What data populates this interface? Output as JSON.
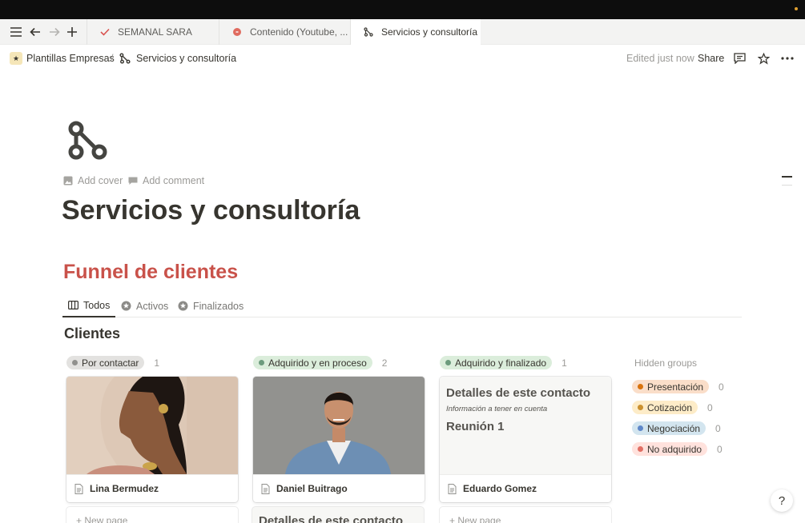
{
  "browser": {
    "tabs": [
      {
        "label": "SEMANAL SARA",
        "icon": "checkmark-icon",
        "icon_color": "#d9534f"
      },
      {
        "label": "Contenido (Youtube, ...",
        "icon": "red-circle-icon",
        "icon_color": "#e06b5f"
      },
      {
        "label": "Servicios y consultoría",
        "icon": "branch-icon"
      }
    ]
  },
  "header": {
    "breadcrumb_parent": "Plantillas Empresas",
    "breadcrumb_separator": "/",
    "breadcrumb_current": "Servicios y consultoría",
    "edited": "Edited just now",
    "share": "Share"
  },
  "page": {
    "add_cover": "Add cover",
    "add_comment": "Add comment",
    "title": "Servicios y consultoría",
    "section_heading": "Funnel de clientes",
    "section_heading_color": "#c9524a"
  },
  "views": [
    {
      "label": "Todos",
      "icon": "board-icon"
    },
    {
      "label": "Activos",
      "icon": "star-circle-icon"
    },
    {
      "label": "Finalizados",
      "icon": "star-circle-icon"
    }
  ],
  "database": {
    "title": "Clientes",
    "columns": [
      {
        "label": "Por contactar",
        "count": "1",
        "pill_bg": "#e3e2e0",
        "dot": "#91918e",
        "card": {
          "name": "Lina Bermudez",
          "image": "woman-portrait"
        },
        "new_page": "+ New page"
      },
      {
        "label": "Adquirido y en proceso",
        "count": "2",
        "pill_bg": "#dbeddb",
        "dot": "#6c9b7d",
        "card": {
          "name": "Daniel Buitrago",
          "image": "man-portrait"
        },
        "peek": "Detalles de este contacto"
      },
      {
        "label": "Adquirido y finalizado",
        "count": "1",
        "pill_bg": "#dbeddb",
        "dot": "#6c9b7d",
        "card": {
          "name": "Eduardo Gomez",
          "preview_title": "Detalles de este contacto",
          "preview_subtitle": "Información a tener en cuenta",
          "preview_heading": "Reunión 1"
        },
        "new_page": "+ New page"
      }
    ],
    "hidden_groups": {
      "title": "Hidden groups",
      "items": [
        {
          "label": "Presentación",
          "count": "0",
          "pill_bg": "#fadec9",
          "dot": "#d9730d"
        },
        {
          "label": "Cotización",
          "count": "0",
          "pill_bg": "#fdecc8",
          "dot": "#cb912f"
        },
        {
          "label": "Negociación",
          "count": "0",
          "pill_bg": "#d3e5ef",
          "dot": "#5e87c9"
        },
        {
          "label": "No adquirido",
          "count": "0",
          "pill_bg": "#ffe2dd",
          "dot": "#e16f64"
        }
      ]
    }
  },
  "help": {
    "glyph": "?"
  }
}
